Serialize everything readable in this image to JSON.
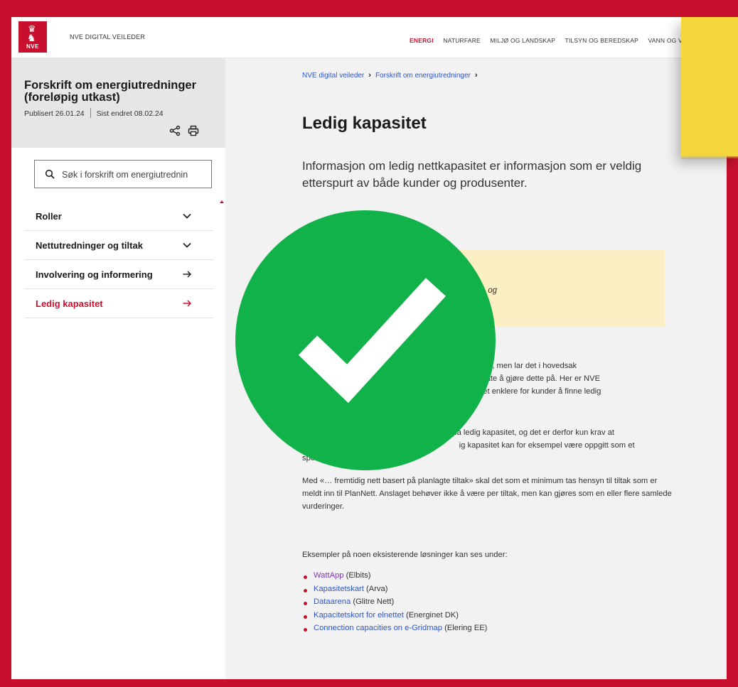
{
  "header": {
    "logo_text": "NVE",
    "site_name": "NVE DIGITAL VEILEDER",
    "nav": [
      {
        "label": "ENERGI",
        "active": true
      },
      {
        "label": "NATURFARE",
        "active": false
      },
      {
        "label": "MILJØ OG LANDSKAP",
        "active": false
      },
      {
        "label": "TILSYN OG BEREDSKAP",
        "active": false
      },
      {
        "label": "VANN OG VA",
        "active": false
      }
    ]
  },
  "sidebar": {
    "title": "Forskrift om energiutredninger (foreløpig utkast)",
    "published": "Publisert 26.01.24",
    "changed": "Sist endret 08.02.24",
    "search_placeholder": "Søk i forskrift om energiutrednin",
    "items": [
      {
        "label": "Roller",
        "icon": "chevron-down-icon",
        "current": false
      },
      {
        "label": "Nettutredninger og tiltak",
        "icon": "chevron-down-icon",
        "current": false
      },
      {
        "label": "Involvering og informering",
        "icon": "arrow-right-icon",
        "current": false
      },
      {
        "label": "Ledig kapasitet",
        "icon": "arrow-right-icon",
        "current": true
      }
    ]
  },
  "main": {
    "breadcrumb": [
      "NVE digital veileder",
      "Forskrift om energiutredninger"
    ],
    "title": "Ledig kapasitet",
    "lead": "Informasjon om ledig nettkapasitet er informasjon som er veldig etterspurt av både kunder og produsenter.",
    "quote_label": "",
    "quote_text": "ublisere a                 g kapasitet i dagens nett, og\nert på pla",
    "paragraphs": [
      "   er ikke tenkt at                                              ir oppfylt, men lar det i hovedsak\n      op til nett                                                      sig måte å gjøre dette på. Her er NVE\n         l fel                                                          gjør det enklere for kunder å finne ledig\n                                                                        nivå.",
      "                                                                    på ledig kapasitet, og det er derfor kun krav at\n                                                                       ig kapasitet kan for eksempel være oppgitt som et\nspenn.",
      "Med «… fremtidig nett basert på planlagte tiltak» skal det som et minimum tas hensyn til tiltak som er meldt inn til PlanNett. Anslaget behøver ikke å være per tiltak, men kan gjøres som en eller flere samlede vurderinger.",
      "Eksempler på noen eksisterende løsninger kan ses under:"
    ],
    "links": [
      {
        "link": "WattApp",
        "note": "(Elbits)"
      },
      {
        "link": "Kapasitetskart",
        "note": "(Arva)"
      },
      {
        "link": "Dataarena",
        "note": "(Glitre Nett)"
      },
      {
        "link": "Kapacitetskort for elnettet",
        "note": "(Energinet DK)"
      },
      {
        "link": "Connection capacities on e-Gridmap",
        "note": "(Elering EE)"
      }
    ]
  },
  "colors": {
    "brand_red": "#c8102e",
    "check_green": "#12b24a",
    "sticky_yellow": "#f5d63d",
    "quote_bg": "#fdefc4",
    "link_blue": "#2f56c9"
  }
}
